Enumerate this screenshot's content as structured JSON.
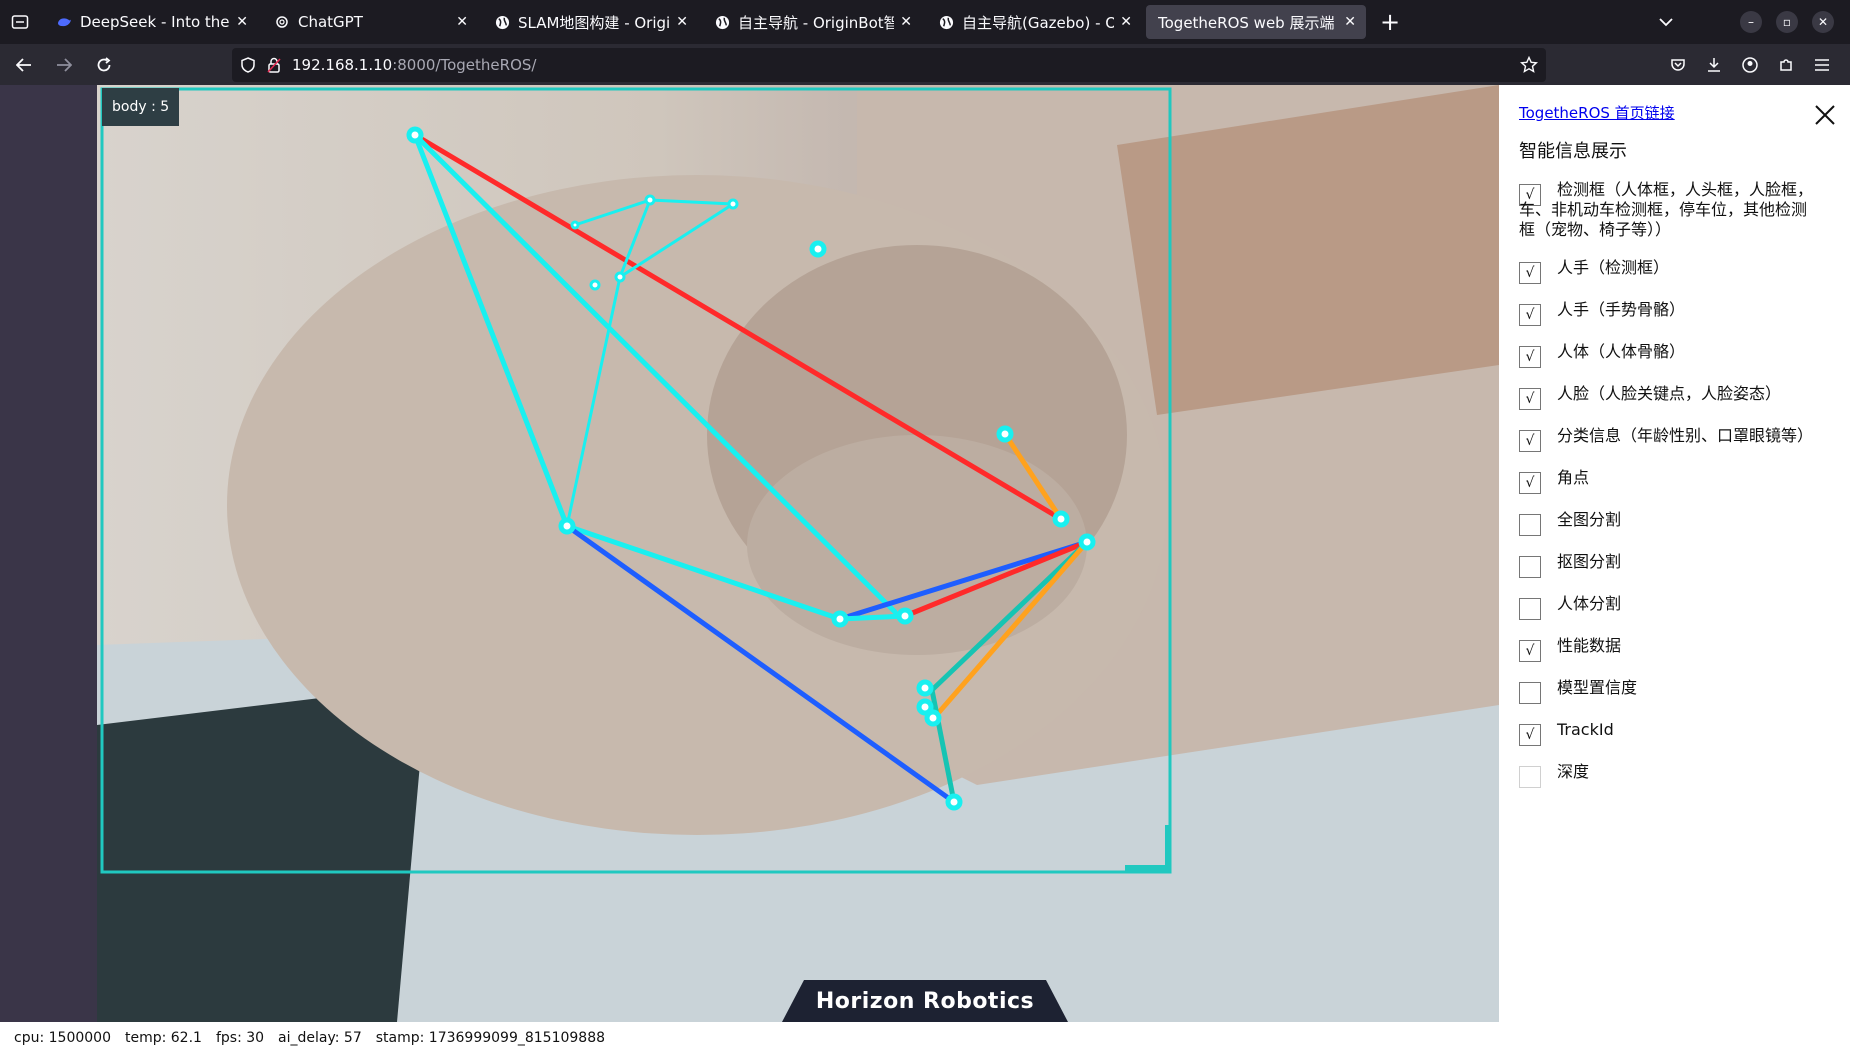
{
  "browser": {
    "tabs": [
      {
        "title": "DeepSeek - Into the Unk",
        "icon": "deepseek-whale-icon",
        "active": false
      },
      {
        "title": "ChatGPT",
        "icon": "openai-logo-icon",
        "active": false
      },
      {
        "title": "SLAM地图构建 - OriginB",
        "icon": "globe-icon",
        "active": false
      },
      {
        "title": "自主导航 - OriginBot智能",
        "icon": "globe-icon",
        "active": false
      },
      {
        "title": "自主导航(Gazebo) - Origi",
        "icon": "globe-icon",
        "active": false
      },
      {
        "title": "TogetheROS web 展示端",
        "icon": "",
        "active": true
      }
    ],
    "url_host": "192.168.1.10",
    "url_path": ":8000/TogetheROS/"
  },
  "video": {
    "body_label": "body : 5",
    "brand": "Horizon  Robotics"
  },
  "panel": {
    "home_link": "TogetheROS 首页链接",
    "heading": "智能信息展示",
    "options": [
      {
        "label": "检测框（人体框，人头框，人脸框，车、非机动车检测框，停车位，其他检测框（宠物、椅子等））",
        "checked": true
      },
      {
        "label": "人手（检测框）",
        "checked": true
      },
      {
        "label": "人手（手势骨骼）",
        "checked": true
      },
      {
        "label": "人体（人体骨骼）",
        "checked": true
      },
      {
        "label": "人脸（人脸关键点，人脸姿态）",
        "checked": true
      },
      {
        "label": "分类信息（年龄性别、口罩眼镜等）",
        "checked": true
      },
      {
        "label": "角点",
        "checked": true
      },
      {
        "label": "全图分割",
        "checked": false
      },
      {
        "label": "抠图分割",
        "checked": false
      },
      {
        "label": "人体分割",
        "checked": false
      },
      {
        "label": "性能数据",
        "checked": true
      },
      {
        "label": "模型置信度",
        "checked": false
      },
      {
        "label": "TrackId",
        "checked": true
      },
      {
        "label": "深度",
        "checked": false
      }
    ],
    "check_mark": "√"
  },
  "status": {
    "cpu": "cpu: 1500000",
    "temp": "temp: 62.1",
    "fps": "fps: 30",
    "ai_delay": "ai_delay: 57",
    "stamp": "stamp: 1736999099_815109888"
  },
  "colors": {
    "skeleton_cyan": "#19f0f0",
    "skeleton_red": "#ff2a2a",
    "skeleton_blue": "#1e5eff",
    "skeleton_orange": "#ffa21e",
    "skeleton_teal": "#16c4b3",
    "bbox": "#20c8c0"
  }
}
